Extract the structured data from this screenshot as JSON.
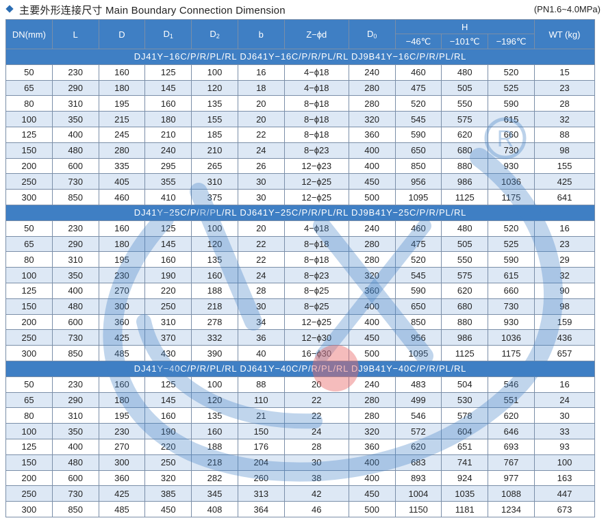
{
  "header": {
    "title": "主要外形连接尺寸 Main Boundary Connection Dimension",
    "pressure": "(PN1.6~4.0MPa)"
  },
  "columns": {
    "dn": "DN(mm)",
    "l": "L",
    "d": "D",
    "d1": "D",
    "d1_sub": "1",
    "d2": "D",
    "d2_sub": "2",
    "b": "b",
    "zd": "Z−ϕd",
    "d0": "D",
    "d0_sub": "0",
    "h": "H",
    "h_46": "−46℃",
    "h_101": "−101℃",
    "h_196": "−196℃",
    "wt": "WT (kg)"
  },
  "groups": [
    {
      "label": "DJ41Y−16C/P/R/PL/RL   DJ641Y−16C/P/R/PL/RL   DJ9B41Y−16C/P/R/PL/RL",
      "rows": [
        [
          "50",
          "230",
          "160",
          "125",
          "100",
          "16",
          "4−ϕ18",
          "240",
          "460",
          "480",
          "520",
          "15"
        ],
        [
          "65",
          "290",
          "180",
          "145",
          "120",
          "18",
          "4−ϕ18",
          "280",
          "475",
          "505",
          "525",
          "23"
        ],
        [
          "80",
          "310",
          "195",
          "160",
          "135",
          "20",
          "8−ϕ18",
          "280",
          "520",
          "550",
          "590",
          "28"
        ],
        [
          "100",
          "350",
          "215",
          "180",
          "155",
          "20",
          "8−ϕ18",
          "320",
          "545",
          "575",
          "615",
          "32"
        ],
        [
          "125",
          "400",
          "245",
          "210",
          "185",
          "22",
          "8−ϕ18",
          "360",
          "590",
          "620",
          "660",
          "88"
        ],
        [
          "150",
          "480",
          "280",
          "240",
          "210",
          "24",
          "8−ϕ23",
          "400",
          "650",
          "680",
          "730",
          "98"
        ],
        [
          "200",
          "600",
          "335",
          "295",
          "265",
          "26",
          "12−ϕ23",
          "400",
          "850",
          "880",
          "930",
          "155"
        ],
        [
          "250",
          "730",
          "405",
          "355",
          "310",
          "30",
          "12−ϕ25",
          "450",
          "956",
          "986",
          "1036",
          "425"
        ],
        [
          "300",
          "850",
          "460",
          "410",
          "375",
          "30",
          "12−ϕ25",
          "500",
          "1095",
          "1125",
          "1175",
          "641"
        ]
      ]
    },
    {
      "label": "DJ41Y−25C/P/R/PL/RL   DJ641Y−25C/P/R/PL/RL   DJ9B41Y−25C/P/R/PL/RL",
      "rows": [
        [
          "50",
          "230",
          "160",
          "125",
          "100",
          "20",
          "4−ϕ18",
          "240",
          "460",
          "480",
          "520",
          "16"
        ],
        [
          "65",
          "290",
          "180",
          "145",
          "120",
          "22",
          "8−ϕ18",
          "280",
          "475",
          "505",
          "525",
          "23"
        ],
        [
          "80",
          "310",
          "195",
          "160",
          "135",
          "22",
          "8−ϕ18",
          "280",
          "520",
          "550",
          "590",
          "29"
        ],
        [
          "100",
          "350",
          "230",
          "190",
          "160",
          "24",
          "8−ϕ23",
          "320",
          "545",
          "575",
          "615",
          "32"
        ],
        [
          "125",
          "400",
          "270",
          "220",
          "188",
          "28",
          "8−ϕ25",
          "360",
          "590",
          "620",
          "660",
          "90"
        ],
        [
          "150",
          "480",
          "300",
          "250",
          "218",
          "30",
          "8−ϕ25",
          "400",
          "650",
          "680",
          "730",
          "98"
        ],
        [
          "200",
          "600",
          "360",
          "310",
          "278",
          "34",
          "12−ϕ25",
          "400",
          "850",
          "880",
          "930",
          "159"
        ],
        [
          "250",
          "730",
          "425",
          "370",
          "332",
          "36",
          "12−ϕ30",
          "450",
          "956",
          "986",
          "1036",
          "436"
        ],
        [
          "300",
          "850",
          "485",
          "430",
          "390",
          "40",
          "16−ϕ30",
          "500",
          "1095",
          "1125",
          "1175",
          "657"
        ]
      ]
    },
    {
      "label": "DJ41Y−40C/P/R/PL/RL   DJ641Y−40C/P/R/PL/RL   DJ9B41Y−40C/P/R/PL/RL",
      "rows": [
        [
          "50",
          "230",
          "160",
          "125",
          "100",
          "88",
          "20",
          "240",
          "483",
          "504",
          "546",
          "16"
        ],
        [
          "65",
          "290",
          "180",
          "145",
          "120",
          "110",
          "22",
          "280",
          "499",
          "530",
          "551",
          "24"
        ],
        [
          "80",
          "310",
          "195",
          "160",
          "135",
          "21",
          "22",
          "280",
          "546",
          "578",
          "620",
          "30"
        ],
        [
          "100",
          "350",
          "230",
          "190",
          "160",
          "150",
          "24",
          "320",
          "572",
          "604",
          "646",
          "33"
        ],
        [
          "125",
          "400",
          "270",
          "220",
          "188",
          "176",
          "28",
          "360",
          "620",
          "651",
          "693",
          "93"
        ],
        [
          "150",
          "480",
          "300",
          "250",
          "218",
          "204",
          "30",
          "400",
          "683",
          "741",
          "767",
          "100"
        ],
        [
          "200",
          "600",
          "360",
          "320",
          "282",
          "260",
          "38",
          "400",
          "893",
          "924",
          "977",
          "163"
        ],
        [
          "250",
          "730",
          "425",
          "385",
          "345",
          "313",
          "42",
          "450",
          "1004",
          "1035",
          "1088",
          "447"
        ],
        [
          "300",
          "850",
          "485",
          "450",
          "408",
          "364",
          "46",
          "500",
          "1150",
          "1181",
          "1234",
          "673"
        ]
      ]
    }
  ],
  "watermark": {
    "registered_symbol": "®",
    "accent": "#3f7fc4",
    "dot": "#e86a6a"
  }
}
